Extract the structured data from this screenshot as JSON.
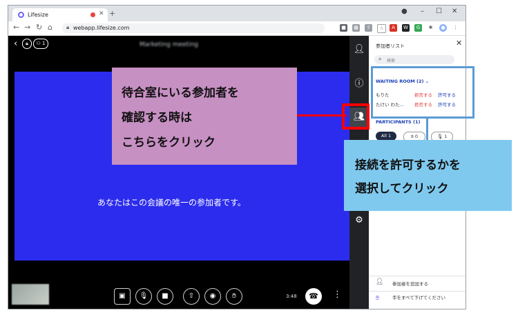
{
  "browser": {
    "tab_title": "Lifesize",
    "url": "webapp.lifesize.com",
    "ext_icons": [
      "camera-icon",
      "qr-icon",
      "share-icon",
      "star-icon",
      "pdf-icon",
      "ext-icon",
      "grid-icon",
      "puzzle-icon",
      "profile-icon",
      "menu-icon"
    ]
  },
  "meeting": {
    "title": "Marketing meeting",
    "participant_pill": "1",
    "alone_message": "あなたはこの会議の唯一の参加者です。",
    "timer": "3:48"
  },
  "panel": {
    "title": "参加者リスト",
    "search_placeholder": "検索",
    "waiting_room_label": "WAITING ROOM (2)",
    "waiting": [
      {
        "name": "もりた",
        "deny": "拒否する",
        "allow": "許可する"
      },
      {
        "name": "たけい わた...",
        "deny": "拒否する",
        "allow": "許可する"
      }
    ],
    "participants_label": "PARTICIPANTS (1)",
    "chips": [
      {
        "label": "All",
        "count": "1"
      },
      {
        "label": "",
        "count": "0"
      },
      {
        "label": "",
        "count": "1"
      }
    ],
    "add_participant": "参加者を追加する",
    "lower_hands": "手をすべて下げてください"
  },
  "annotations": {
    "callout1": [
      "待合室にいる参加者を",
      "確認する時は",
      "こちらをクリック"
    ],
    "callout2": [
      "接続を許可するかを",
      "選択してクリック"
    ]
  },
  "colors": {
    "video_bg": "#2c2cee",
    "callout1_bg": "#c790c3",
    "callout2_bg": "#7fc9ef",
    "highlight_red": "#ff0000",
    "highlight_blue": "#5b9bd5"
  }
}
